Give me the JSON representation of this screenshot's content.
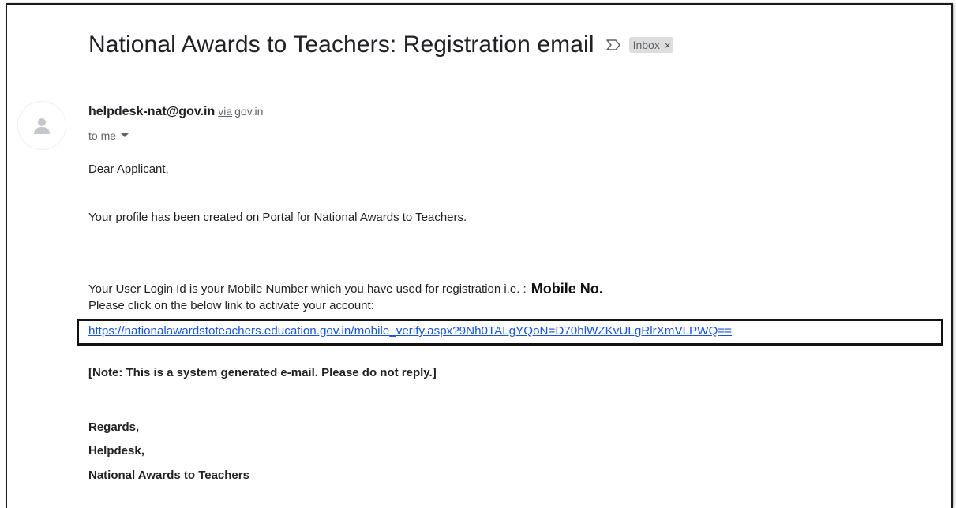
{
  "email": {
    "subject": "National Awards to Teachers: Registration email",
    "label": "Inbox",
    "label_close": "×",
    "sender": {
      "email": "helpdesk-nat@gov.in",
      "via_label": "via",
      "via_domain": "gov.in"
    },
    "recipient": "to me",
    "body": {
      "greeting": "Dear Applicant,",
      "profile_line": "Your profile has been created on Portal for National Awards to Teachers.",
      "login_line": "Your User Login Id is your Mobile Number which you have used for registration i.e. :",
      "mobile_placeholder": "Mobile No.",
      "click_line": "Please click on the below link to activate your account:",
      "activation_link": "https://nationalawardstoteachers.education.gov.in/mobile_verify.aspx?9Nh0TALgYQoN=D70hlWZKvULgRlrXmVLPWQ==",
      "note": "[Note: This is a system generated e-mail. Please do not reply.]",
      "signature": [
        "Regards,",
        "Helpdesk,",
        "National Awards to Teachers"
      ]
    }
  },
  "icons": {
    "important": "important-marker-icon",
    "avatar": "person-icon",
    "dropdown": "caret-down-icon"
  },
  "colors": {
    "link": "#1a55d8",
    "label_bg": "#dddddd",
    "highlight_border": "#111111"
  }
}
